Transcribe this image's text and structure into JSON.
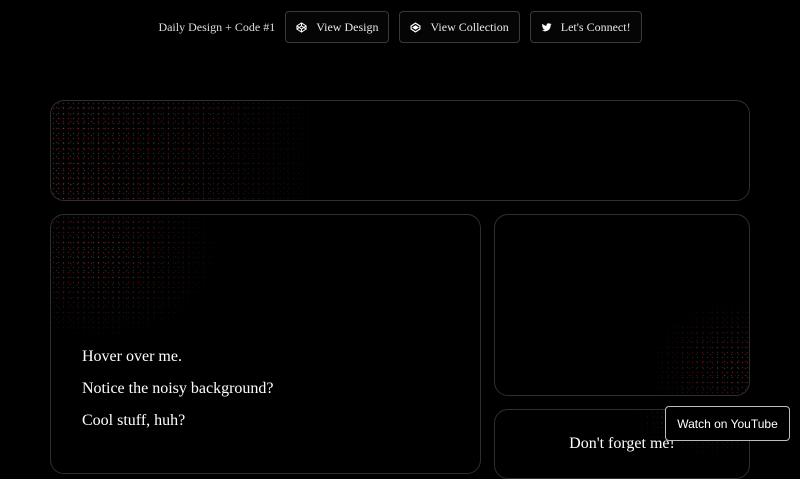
{
  "header": {
    "brand": "Daily Design + Code #1",
    "buttons": [
      {
        "label": "View Design",
        "icon": "codepen-icon"
      },
      {
        "label": "View Collection",
        "icon": "codepen-collection-icon"
      },
      {
        "label": "Let's Connect!",
        "icon": "twitter-icon"
      }
    ]
  },
  "main": {
    "lines": [
      "Hover over me.",
      "Notice the noisy background?",
      "Cool stuff, huh?"
    ],
    "reminder": "Don't forget me!"
  },
  "youtube_button": {
    "label": "Watch on YouTube"
  },
  "colors": {
    "background": "#000000",
    "border": "#2e2e2e",
    "noise_accent": "#ff5050"
  }
}
